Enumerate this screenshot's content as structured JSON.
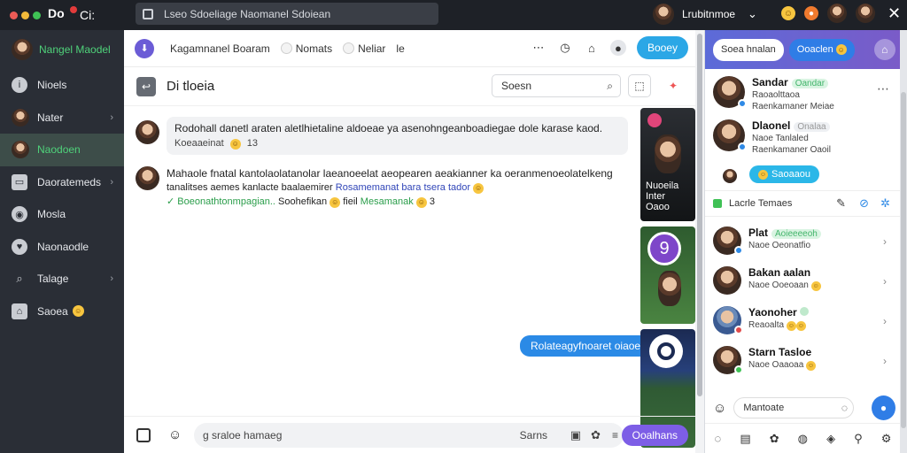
{
  "app": {
    "title": "Ci:",
    "logo_text": "Do",
    "search_text": "Lseo Sdoeliage Naomanel Sdoiean"
  },
  "user": {
    "name": "Lrubitnmoe"
  },
  "sidebar": {
    "items": [
      {
        "label": "Nangel Maodel",
        "icon": "avatar"
      },
      {
        "label": "Nioels",
        "icon": "info-icon"
      },
      {
        "label": "Nater",
        "icon": "avatar"
      },
      {
        "label": "Naodoen",
        "icon": "avatar"
      },
      {
        "label": "Daoratemeds",
        "icon": "monitor-icon"
      },
      {
        "label": "Mosla",
        "icon": "globe-icon"
      },
      {
        "label": "Naonaodle",
        "icon": "heart-icon"
      },
      {
        "label": "Talage",
        "icon": "search-icon"
      },
      {
        "label": "Saoea",
        "icon": "home-icon"
      }
    ]
  },
  "filterbar": {
    "chips": [
      "Kagamnanel Boaram",
      "Nomats",
      "Neliar",
      "le"
    ],
    "primary_button": "Booey"
  },
  "chat": {
    "title": "Di tloeia",
    "search_text": "Soesn",
    "messages": [
      {
        "text": "Rodohall danetl araten aletlhietaline aldoeae ya asenohngeanboadiegae dole karase kaod.",
        "meta": "Koeaaeinat",
        "meta_count": "13"
      },
      {
        "line1": "Mahaole fnatal kantolaolatanolar laeanoeelat aeopearen aeakianner ka oeranmenoeolatelkeng",
        "line2_prefix": "tanalitses aemes kanlacte baalaemirer",
        "line2_link": "Rosamemanat bara",
        "line2_link2": "tsera tador",
        "line3_ok": "Boeonathtonmpagian..",
        "line3_text": "Soohefikan",
        "line3_mid": "fieil",
        "line3_ok2": "Mesamanak",
        "line3_count": "3"
      }
    ],
    "outgoing": "Rolateagyfnoaret oiaoea"
  },
  "media": {
    "m1_caption": "Nuoeila Inter",
    "m1_sub": "Oaoo",
    "m2_badge": "9"
  },
  "composer": {
    "placeholder": "g sraloe hamaeg",
    "right_label": "Sarns",
    "send_button": "Ooalhans"
  },
  "rpanel": {
    "tab1": "Soea hnalan",
    "tab2": "Ooaclen",
    "contacts_top": [
      {
        "name": "Sandar",
        "tag": "Oandar",
        "sub1": "Raoaolttaoa",
        "sub2": "Raenkamaner Meiae"
      },
      {
        "name": "Dlaonel",
        "tag": "Onalaa",
        "sub1": "Naoe Tanlaled",
        "sub2": "Raenkamaner Oaoil"
      }
    ],
    "cyan_pill": "Saoaaou",
    "section": "Lacrle Temaes",
    "contacts": [
      {
        "name": "Plat",
        "tag": "Aoieeeeoh",
        "sub": "Naoe Oeonatfio"
      },
      {
        "name": "Bakan aalan",
        "tag": "",
        "sub": "Naoe Ooeoaan"
      },
      {
        "name": "Yaonoher",
        "tag": "",
        "sub": "Reaoalta"
      },
      {
        "name": "Starn Tasloe",
        "tag": "",
        "sub": "Naoe Oaaoaa"
      }
    ],
    "compose_placeholder": "Mantoate"
  },
  "colors": {
    "topbar": "#1e2127",
    "sidebar": "#2a2e36",
    "accent_blue": "#2ba7e6",
    "accent_purple": "#7d5ee6"
  }
}
